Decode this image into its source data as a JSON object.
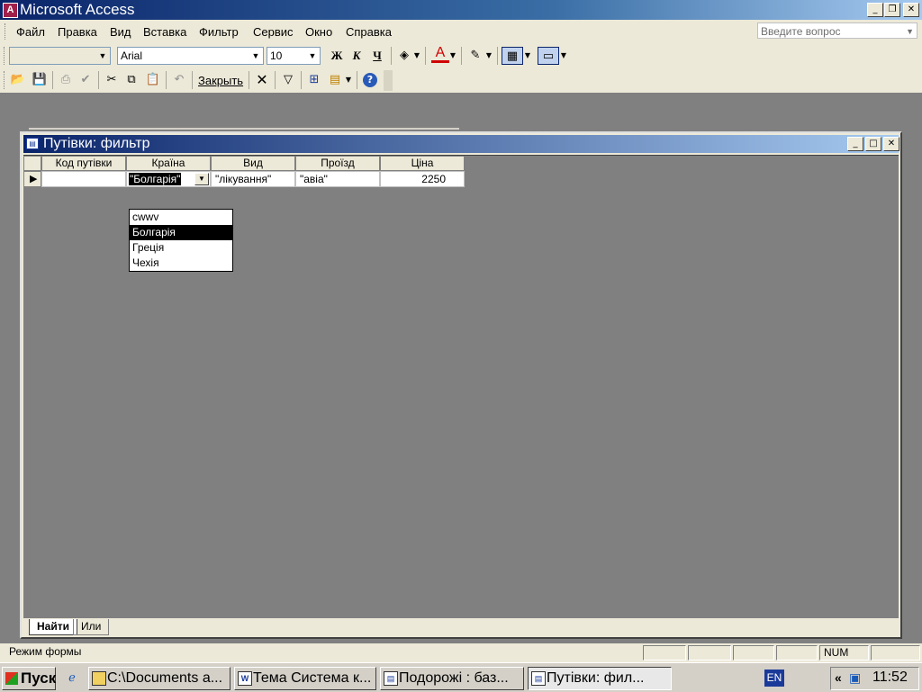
{
  "app": {
    "title": "Microsoft Access",
    "icon_letter": "A"
  },
  "window_controls": {
    "minimize": "_",
    "restore": "❐",
    "close": "✕"
  },
  "menu": {
    "items": [
      "Файл",
      "Правка",
      "Вид",
      "Вставка",
      "Фильтр",
      "Сервис",
      "Окно",
      "Справка"
    ],
    "ask_placeholder": "Введите вопрос"
  },
  "format_toolbar": {
    "object_combo": "",
    "font": "Arial",
    "size": "10",
    "bold": "Ж",
    "italic": "К",
    "underline": "Ч",
    "font_color_letter": "A"
  },
  "filter_toolbar": {
    "close_label": "Закрыть"
  },
  "child_window": {
    "title": "Путівки: фильтр",
    "columns": [
      "Код путівки",
      "Країна",
      "Вид",
      "Проїзд",
      "Ціна"
    ],
    "row": {
      "code": "",
      "country": "\"Болгарія\"",
      "kind": "\"лікування\"",
      "transport": "\"авіа\"",
      "price": "2250"
    },
    "dropdown_options": [
      "cwwv",
      "Болгарія",
      "Греція",
      "Чехія"
    ],
    "selected_option": "Болгарія",
    "tabs": [
      "Найти",
      "Или"
    ]
  },
  "statusbar": {
    "mode": "Режим формы",
    "num": "NUM"
  },
  "taskbar": {
    "start": "Пуск",
    "tasks": [
      "C:\\Documents a...",
      "Тема Система к...",
      "Подорожі : баз...",
      "Путівки: фил..."
    ],
    "lang": "EN",
    "clock": "11:52"
  }
}
